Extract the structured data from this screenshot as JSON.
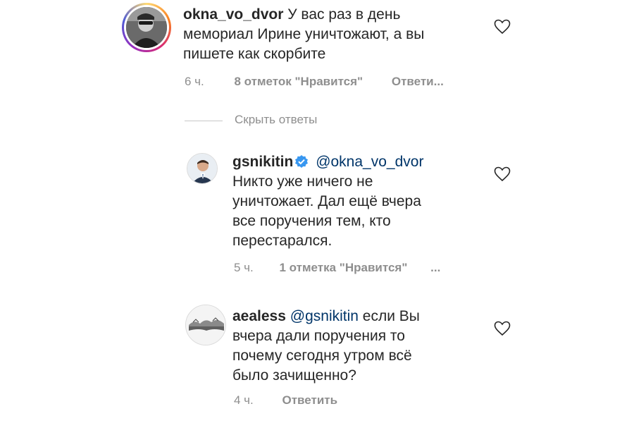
{
  "comments": [
    {
      "username": "okna_vo_dvor",
      "text": "У вас раз в день мемориал Ирине уничтожают, а вы пишете как скорбите",
      "lines": [
        "У вас раз в день",
        "мемориал Ирине уничтожают, а вы",
        "пишете как скорбите"
      ],
      "time": "6 ч.",
      "likes": "8 отметок \"Нравится\"",
      "reply": "Ответи...",
      "avatar_icon": "user-photo-icon",
      "has_story_ring": true
    },
    {
      "username": "gsnikitin",
      "verified": true,
      "mention": "@okna_vo_dvor",
      "lines": [
        "Никто уже  ничего не",
        "уничтожает. Дал ещё вчера",
        "все поручения тем, кто",
        "перестарался."
      ],
      "time": "5 ч.",
      "likes": "1 отметка \"Нравится\"",
      "more": "...",
      "avatar_icon": "user-photo-icon"
    },
    {
      "username": "aealess",
      "mention": "@gsnikitin",
      "lines": [
        "если Вы",
        "вчера дали поручения то",
        "почему сегодня утром всё",
        "было зачищенно?"
      ],
      "time": "4 ч.",
      "reply": "Ответить",
      "avatar_icon": "landscape-icon"
    }
  ],
  "replies_toggle": "Скрыть ответы",
  "colors": {
    "text": "#262626",
    "muted": "#8e8e8e",
    "mention": "#003569",
    "verified": "#3897f0"
  }
}
